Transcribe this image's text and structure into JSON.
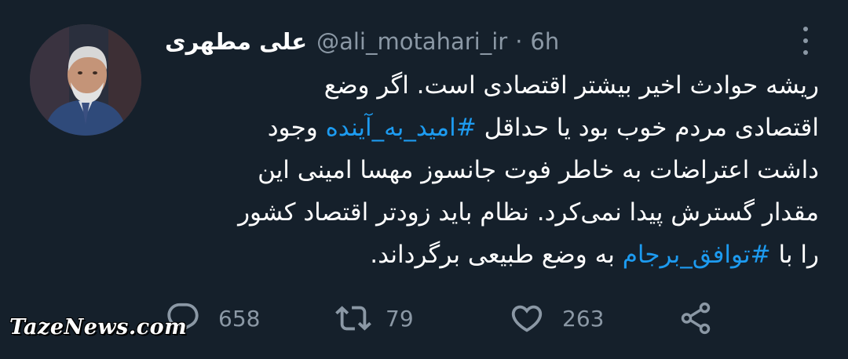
{
  "tweet": {
    "display_name": "علی مطهری",
    "handle": "@ali_motahari_ir",
    "separator": "·",
    "time": "6h",
    "lines": [
      {
        "parts": [
          {
            "text": "ریشه حوادث اخیر بیشتر اقتصادی است. اگر وضع",
            "hashtag": false
          }
        ]
      },
      {
        "parts": [
          {
            "text": "اقتصادی مردم خوب بود یا حداقل ",
            "hashtag": false
          },
          {
            "text": "#امید_به_آینده",
            "hashtag": true
          },
          {
            "text": " وجود",
            "hashtag": false
          }
        ]
      },
      {
        "parts": [
          {
            "text": "داشت اعتراضات به خاطر فوت جانسوز مهسا امینی این",
            "hashtag": false
          }
        ]
      },
      {
        "parts": [
          {
            "text": "مقدار گسترش پیدا نمی‌کرد. نظام باید زودتر اقتصاد کشور",
            "hashtag": false
          }
        ]
      },
      {
        "parts": [
          {
            "text": "را با ",
            "hashtag": false
          },
          {
            "text": "#توافق_برجام",
            "hashtag": true
          },
          {
            "text": " به وضع طبیعی برگرداند.",
            "hashtag": false
          }
        ]
      }
    ],
    "actions": {
      "reply_icon": "reply-icon",
      "reply_count": "658",
      "retweet_icon": "retweet-icon",
      "retweet_count": "79",
      "like_icon": "heart-icon",
      "like_count": "263",
      "share_icon": "share-icon"
    }
  },
  "watermark": "TazeNews.com",
  "colors": {
    "background": "#15202b",
    "text": "#ffffff",
    "secondary": "#8b98a5",
    "link": "#1d9bf0"
  }
}
